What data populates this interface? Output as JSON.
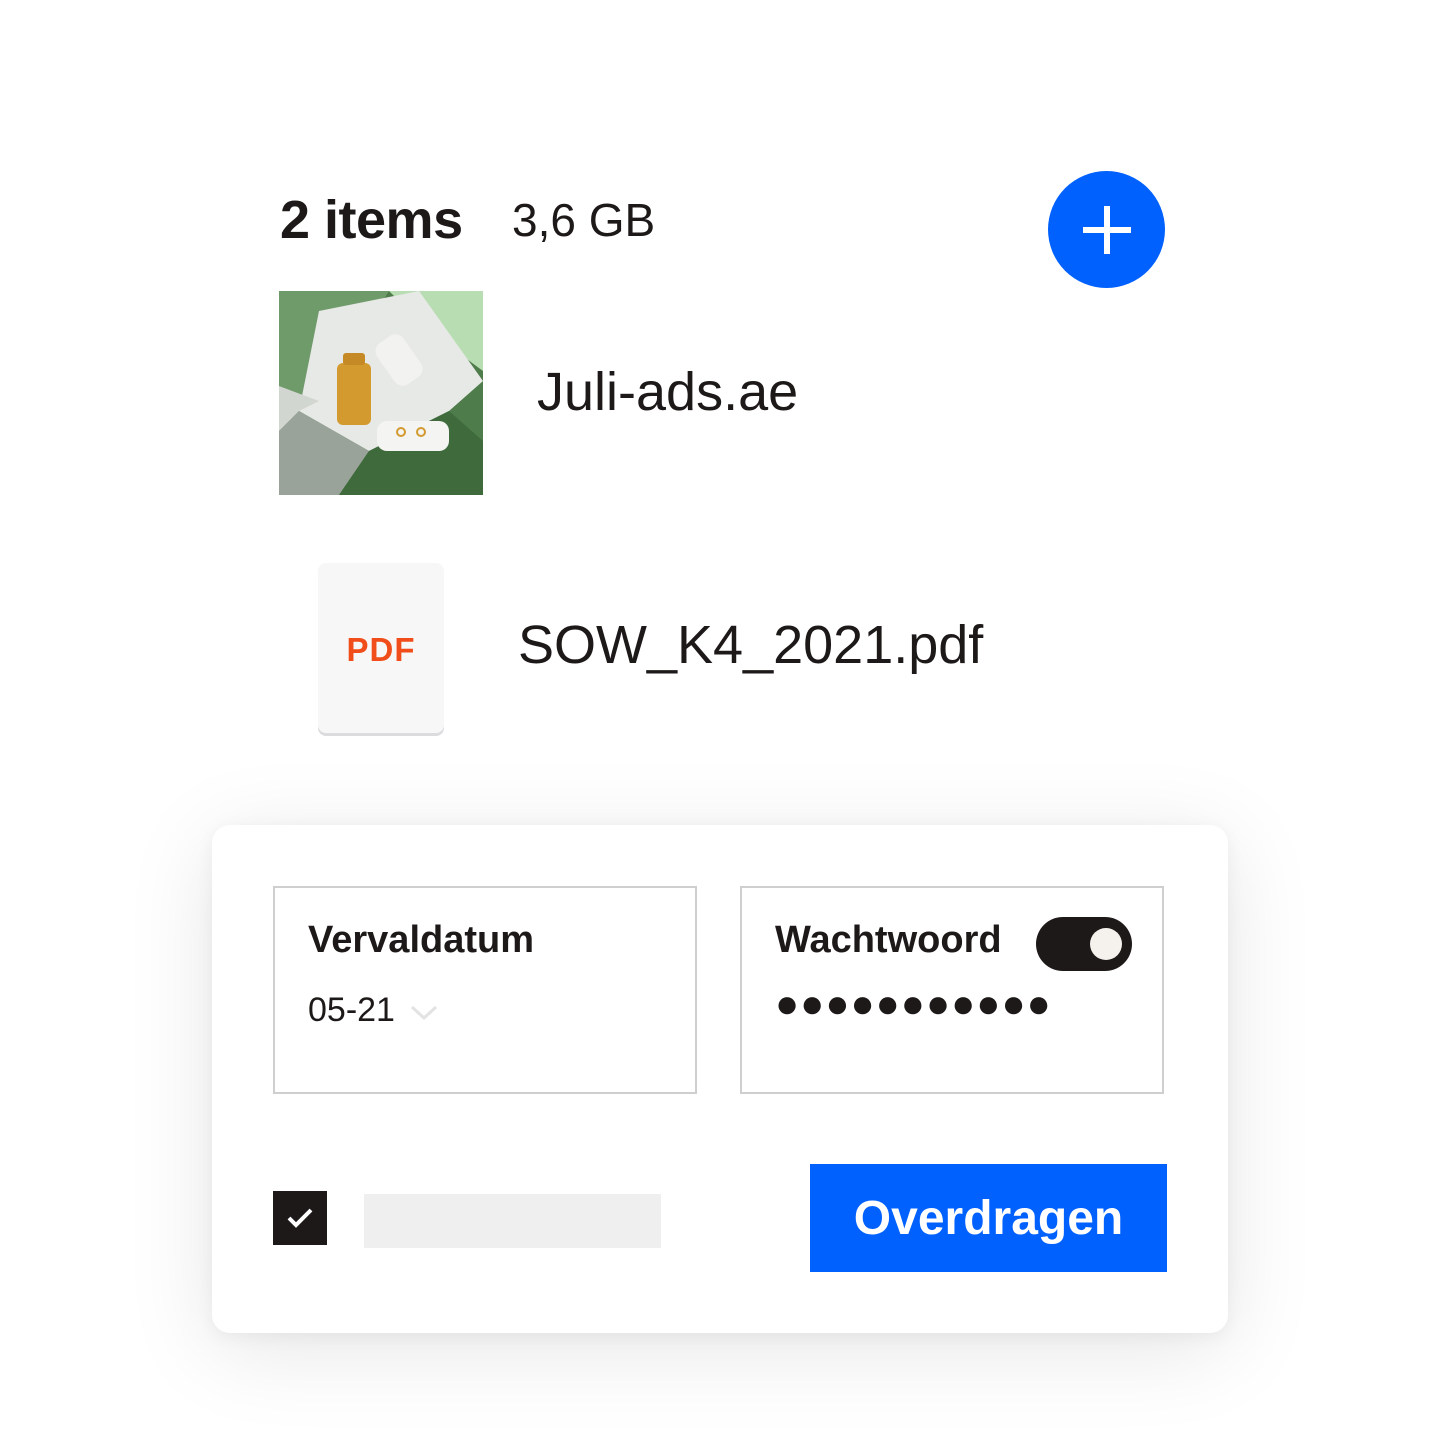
{
  "header": {
    "item_count": "2 items",
    "total_size": "3,6 GB",
    "add_icon": "plus-icon"
  },
  "files": [
    {
      "name": "Juli-ads.ae",
      "icon": "image-thumbnail"
    },
    {
      "name": "SOW_K4_2021.pdf",
      "icon": "pdf-file-icon",
      "icon_label": "PDF"
    }
  ],
  "settings": {
    "expiry": {
      "label": "Vervaldatum",
      "value": "05-21",
      "icon": "chevron-down-icon"
    },
    "password": {
      "label": "Wachtwoord",
      "value": "●●●●●●●●●●●",
      "enabled": true
    },
    "checkbox_checked": true,
    "submit_label": "Overdragen"
  },
  "colors": {
    "accent": "#0061fe",
    "pdf": "#f04d1a",
    "text": "#1e1919"
  }
}
